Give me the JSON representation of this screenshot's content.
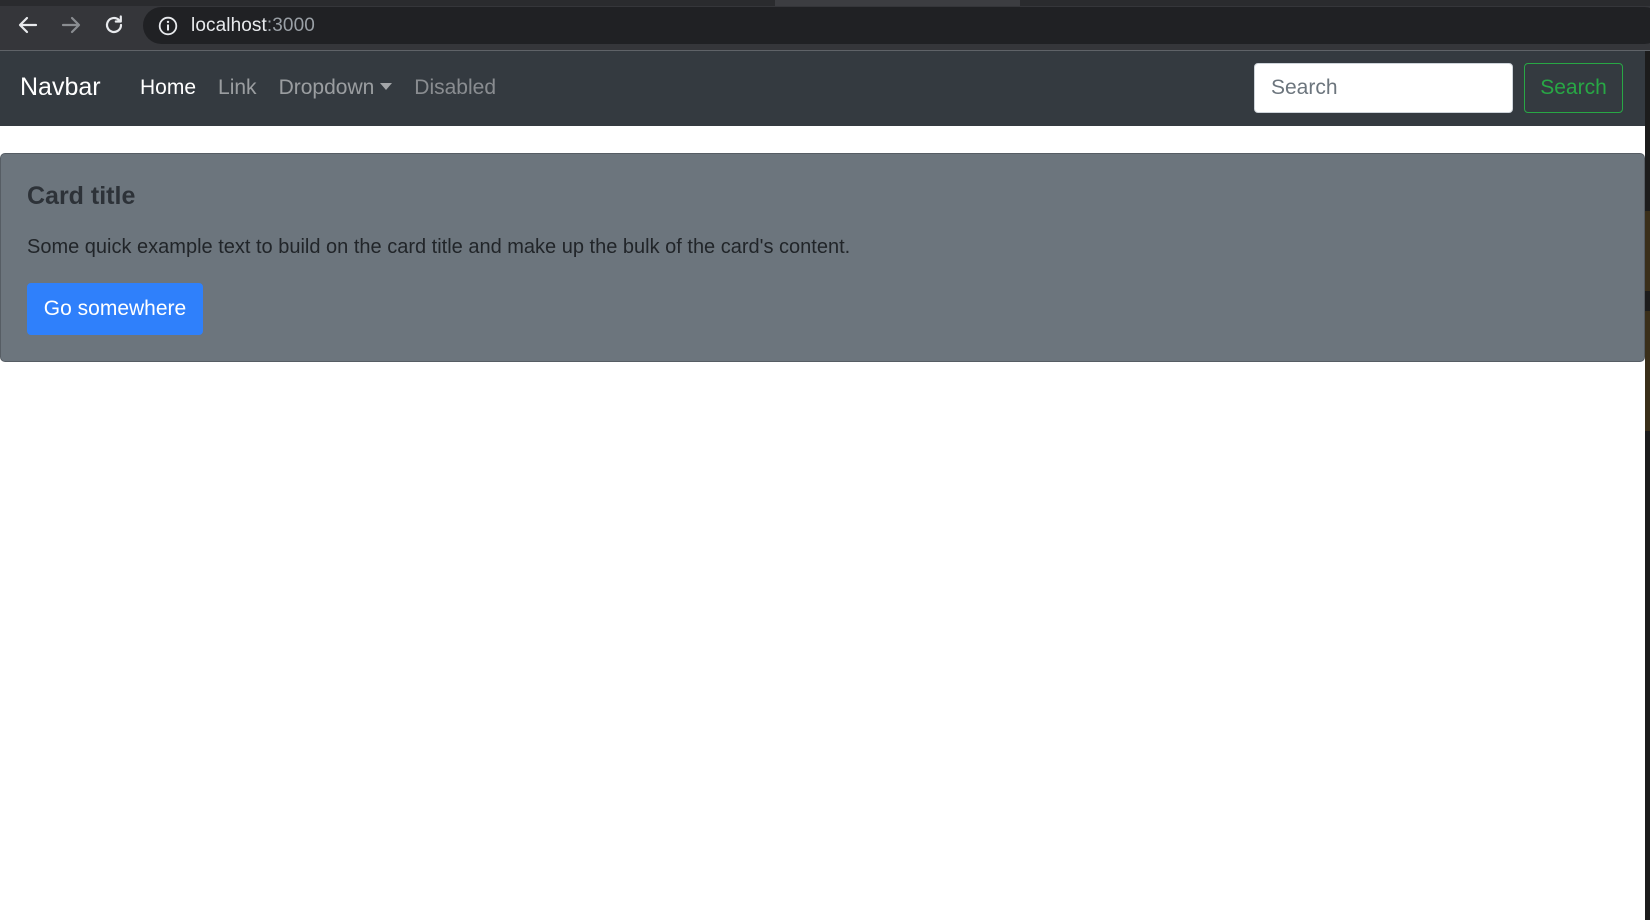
{
  "browser": {
    "url_host": "localhost",
    "url_port": ":3000",
    "icons": {
      "back": "arrow-left-icon",
      "forward": "arrow-right-icon",
      "reload": "reload-icon",
      "site_info": "info-icon"
    }
  },
  "navbar": {
    "brand": "Navbar",
    "links": [
      {
        "label": "Home",
        "state": "active"
      },
      {
        "label": "Link",
        "state": "normal"
      },
      {
        "label": "Dropdown",
        "state": "dropdown"
      },
      {
        "label": "Disabled",
        "state": "disabled"
      }
    ],
    "search": {
      "placeholder": "Search",
      "value": "",
      "button_label": "Search"
    },
    "colors": {
      "background": "#343a40",
      "search_button": "#28a745"
    }
  },
  "card": {
    "title": "Card title",
    "text": "Some quick example text to build on the card title and make up the bulk of the card's content.",
    "button_label": "Go somewhere",
    "colors": {
      "background": "#6c757d",
      "button": "#2f80fb"
    }
  }
}
